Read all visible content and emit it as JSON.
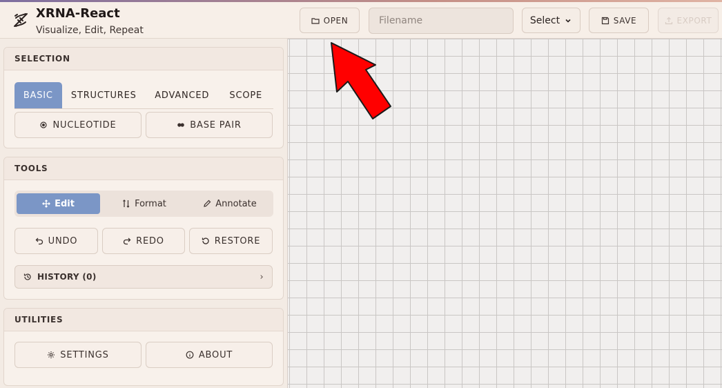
{
  "app": {
    "title": "XRNA-React",
    "subtitle": "Visualize, Edit, Repeat",
    "brand_icon": "dna-helix-icon"
  },
  "toolbar": {
    "open_label": "OPEN",
    "filename_placeholder": "Filename",
    "filename_value": "",
    "select_label": "Select",
    "save_label": "SAVE",
    "export_label": "EXPORT"
  },
  "selection": {
    "heading": "SELECTION",
    "tabs": [
      {
        "label": "BASIC",
        "active": true
      },
      {
        "label": "STRUCTURES",
        "active": false
      },
      {
        "label": "ADVANCED",
        "active": false
      },
      {
        "label": "SCOPE",
        "active": false
      }
    ],
    "nucleotide_label": "NUCLEOTIDE",
    "base_pair_label": "BASE PAIR"
  },
  "tools": {
    "heading": "TOOLS",
    "modes": [
      {
        "label": "Edit",
        "icon": "move-icon",
        "active": true
      },
      {
        "label": "Format",
        "icon": "format-icon",
        "active": false
      },
      {
        "label": "Annotate",
        "icon": "pencil-icon",
        "active": false
      }
    ],
    "undo_label": "UNDO",
    "redo_label": "REDO",
    "restore_label": "RESTORE",
    "history_label": "HISTORY (0)"
  },
  "utilities": {
    "heading": "UTILITIES",
    "settings_label": "SETTINGS",
    "about_label": "ABOUT"
  },
  "colors": {
    "accent": "#7b96c6",
    "background": "#f6efe9",
    "arrow": "#ff0000"
  }
}
